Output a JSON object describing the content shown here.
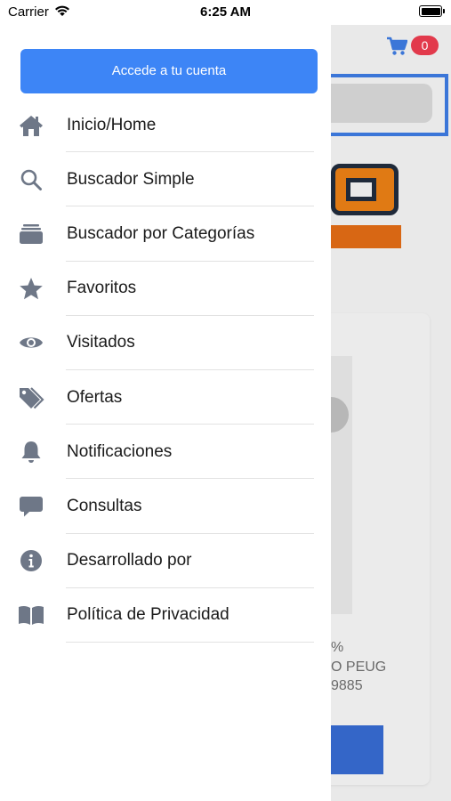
{
  "status_bar": {
    "carrier": "Carrier",
    "time": "6:25 AM",
    "battery_level": 1.0
  },
  "background": {
    "cart_count": "0",
    "product_percent": "%",
    "product_name_fragment": "O PEUG",
    "product_code_fragment": "9885"
  },
  "drawer": {
    "account_button_label": "Accede a tu cuenta",
    "menu": [
      {
        "label": "Inicio/Home",
        "icon": "home-icon"
      },
      {
        "label": "Buscador Simple",
        "icon": "search-icon"
      },
      {
        "label": "Buscador por Categorías",
        "icon": "categories-icon"
      },
      {
        "label": "Favoritos",
        "icon": "star-icon"
      },
      {
        "label": "Visitados",
        "icon": "eye-icon"
      },
      {
        "label": "Ofertas",
        "icon": "tags-icon"
      },
      {
        "label": "Notificaciones",
        "icon": "bell-icon"
      },
      {
        "label": "Consultas",
        "icon": "chat-icon"
      },
      {
        "label": "Desarrollado por",
        "icon": "info-icon"
      },
      {
        "label": "Política de Privacidad",
        "icon": "book-icon"
      }
    ]
  },
  "colors": {
    "icon": "#6e7787",
    "accent": "#3d85f6",
    "badge": "#e23a4c",
    "logo_orange": "#d86714"
  }
}
